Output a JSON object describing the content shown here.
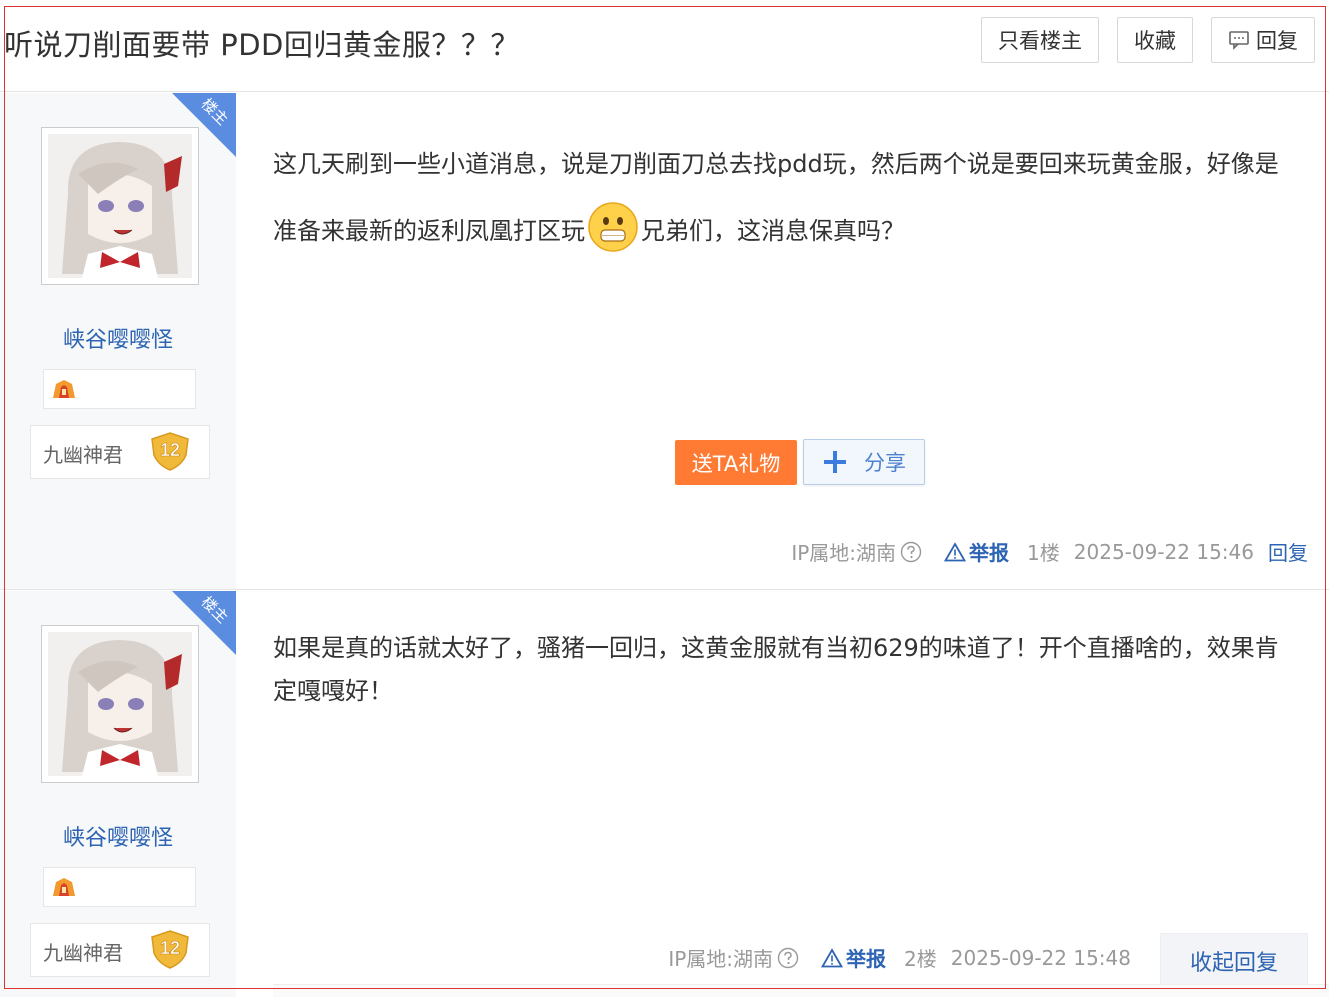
{
  "thread": {
    "title": "听说刀削面要带 PDD回归黄金服？？？",
    "buttons": {
      "only_op": "只看楼主",
      "favorite": "收藏",
      "reply": "回复"
    }
  },
  "posts": [
    {
      "badge": "楼主",
      "author": "峡谷嘤嘤怪",
      "level_title": "九幽神君",
      "level": "12",
      "content_part1": "这几天刷到一些小道消息，说是刀削面刀总去找pdd玩，然后两个说是要回来玩黄金服，好像是准备来最新的返利凤凰打区玩",
      "emoji": "scared-face-emoji",
      "content_part2": "兄弟们，这消息保真吗？",
      "gift_label": "送TA礼物",
      "share_label": "分享",
      "ip": "IP属地:湖南",
      "report": "举报",
      "floor": "1楼",
      "time": "2025-09-22 15:46",
      "reply_link": "回复"
    },
    {
      "badge": "楼主",
      "author": "峡谷嘤嘤怪",
      "level_title": "九幽神君",
      "level": "12",
      "content": "如果是真的话就太好了，骚猪一回归，这黄金服就有当初629的味道了！开个直播啥的，效果肯定嘎嘎好！",
      "ip": "IP属地:湖南",
      "report": "举报",
      "floor": "2楼",
      "time": "2025-09-22 15:48",
      "collapse_label": "收起回复"
    }
  ],
  "colors": {
    "link": "#2d64b3",
    "gift": "#ff7a33",
    "badge": "#5a8de0",
    "level": "#f0b93a"
  }
}
